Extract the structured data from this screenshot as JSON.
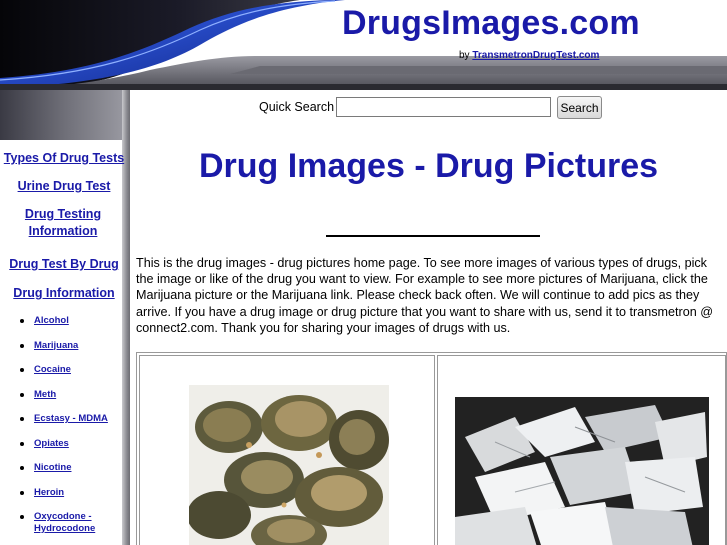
{
  "header": {
    "site_title": "DrugsImages.com",
    "byline_prefix": "by",
    "byline_link": "TransmetronDrugTest.com"
  },
  "sidebar": {
    "links": [
      "Types Of Drug Tests",
      "Urine Drug Test",
      "Drug Testing Information",
      "Drug Test By Drug",
      "Drug Information"
    ],
    "drug_list": [
      "Alcohol",
      "Marijuana",
      "Cocaine",
      "Meth",
      "Ecstasy - MDMA",
      "Opiates",
      "Nicotine",
      "Heroin",
      "Oxycodone - Hydrocodone"
    ]
  },
  "search": {
    "label": "Quick Search",
    "value": "",
    "placeholder": "",
    "button_label": "Search"
  },
  "main": {
    "title": "Drug Images - Drug Pictures",
    "intro": "This is the drug images - drug pictures home page.  To see more images of various types of drugs, pick the image or like of the drug you want to view.  For example to see more pictures of Marijuana, click the Marijuana picture or the Marijuana link.  Please check back often.  We will continue to add pics as they arrive.  If you have a drug image or drug picture that you want to share with us, send it to transmetron @ connect2.com.  Thank you for sharing your images of drugs with us."
  },
  "colors": {
    "link_blue": "#1a1aa8",
    "header_dark": "#0a0a14",
    "swoosh_blue": "#2850d8"
  },
  "icons": {
    "list_bullet": "disc"
  }
}
